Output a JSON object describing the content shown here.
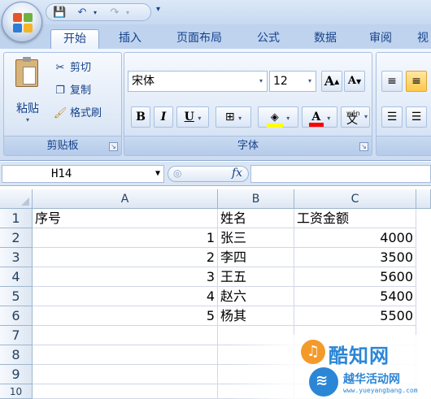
{
  "quick_access": {
    "more_arrow": "▾"
  },
  "tabs": [
    {
      "label": "开始",
      "active": true
    },
    {
      "label": "插入"
    },
    {
      "label": "页面布局"
    },
    {
      "label": "公式"
    },
    {
      "label": "数据"
    },
    {
      "label": "审阅"
    },
    {
      "label": "视"
    }
  ],
  "clipboard": {
    "paste_label": "粘贴",
    "cut_label": "剪切",
    "copy_label": "复制",
    "format_painter_label": "格式刷",
    "group_label": "剪贴板"
  },
  "font": {
    "font_name": "宋体",
    "font_size": "12",
    "grow_label": "A",
    "shrink_label": "A",
    "bold_label": "B",
    "italic_label": "I",
    "underline_label": "U",
    "phonetic_label": "文",
    "phonetic_top": "wén",
    "group_label": "字体",
    "font_color": "#ff0000",
    "fill_color": "#ffff00"
  },
  "formula_bar": {
    "name_box": "H14",
    "fx_label": "fx",
    "formula": ""
  },
  "grid": {
    "columns": [
      "A",
      "B",
      "C"
    ],
    "rows": [
      {
        "num": "1",
        "a": "序号",
        "b": "姓名",
        "c": "工资金额"
      },
      {
        "num": "2",
        "a": "1",
        "b": "张三",
        "c": "4000"
      },
      {
        "num": "3",
        "a": "2",
        "b": "李四",
        "c": "3500"
      },
      {
        "num": "4",
        "a": "3",
        "b": "王五",
        "c": "5600"
      },
      {
        "num": "5",
        "a": "4",
        "b": "赵六",
        "c": "5400"
      },
      {
        "num": "6",
        "a": "5",
        "b": "杨其",
        "c": "5500"
      },
      {
        "num": "7",
        "a": "",
        "b": "",
        "c": ""
      },
      {
        "num": "8",
        "a": "",
        "b": "",
        "c": ""
      },
      {
        "num": "9",
        "a": "",
        "b": "",
        "c": ""
      },
      {
        "num": "10",
        "a": "",
        "b": "",
        "c": ""
      }
    ]
  },
  "watermark": {
    "text1": "酷知网",
    "text2": "越华活动网",
    "text3": "www.yueyangbang.com"
  },
  "colors": {
    "ribbon_text": "#15428b",
    "header_bg": "#dde7f3",
    "grid_line": "#d0d7e5",
    "watermark_blue": "#2b86d6"
  }
}
